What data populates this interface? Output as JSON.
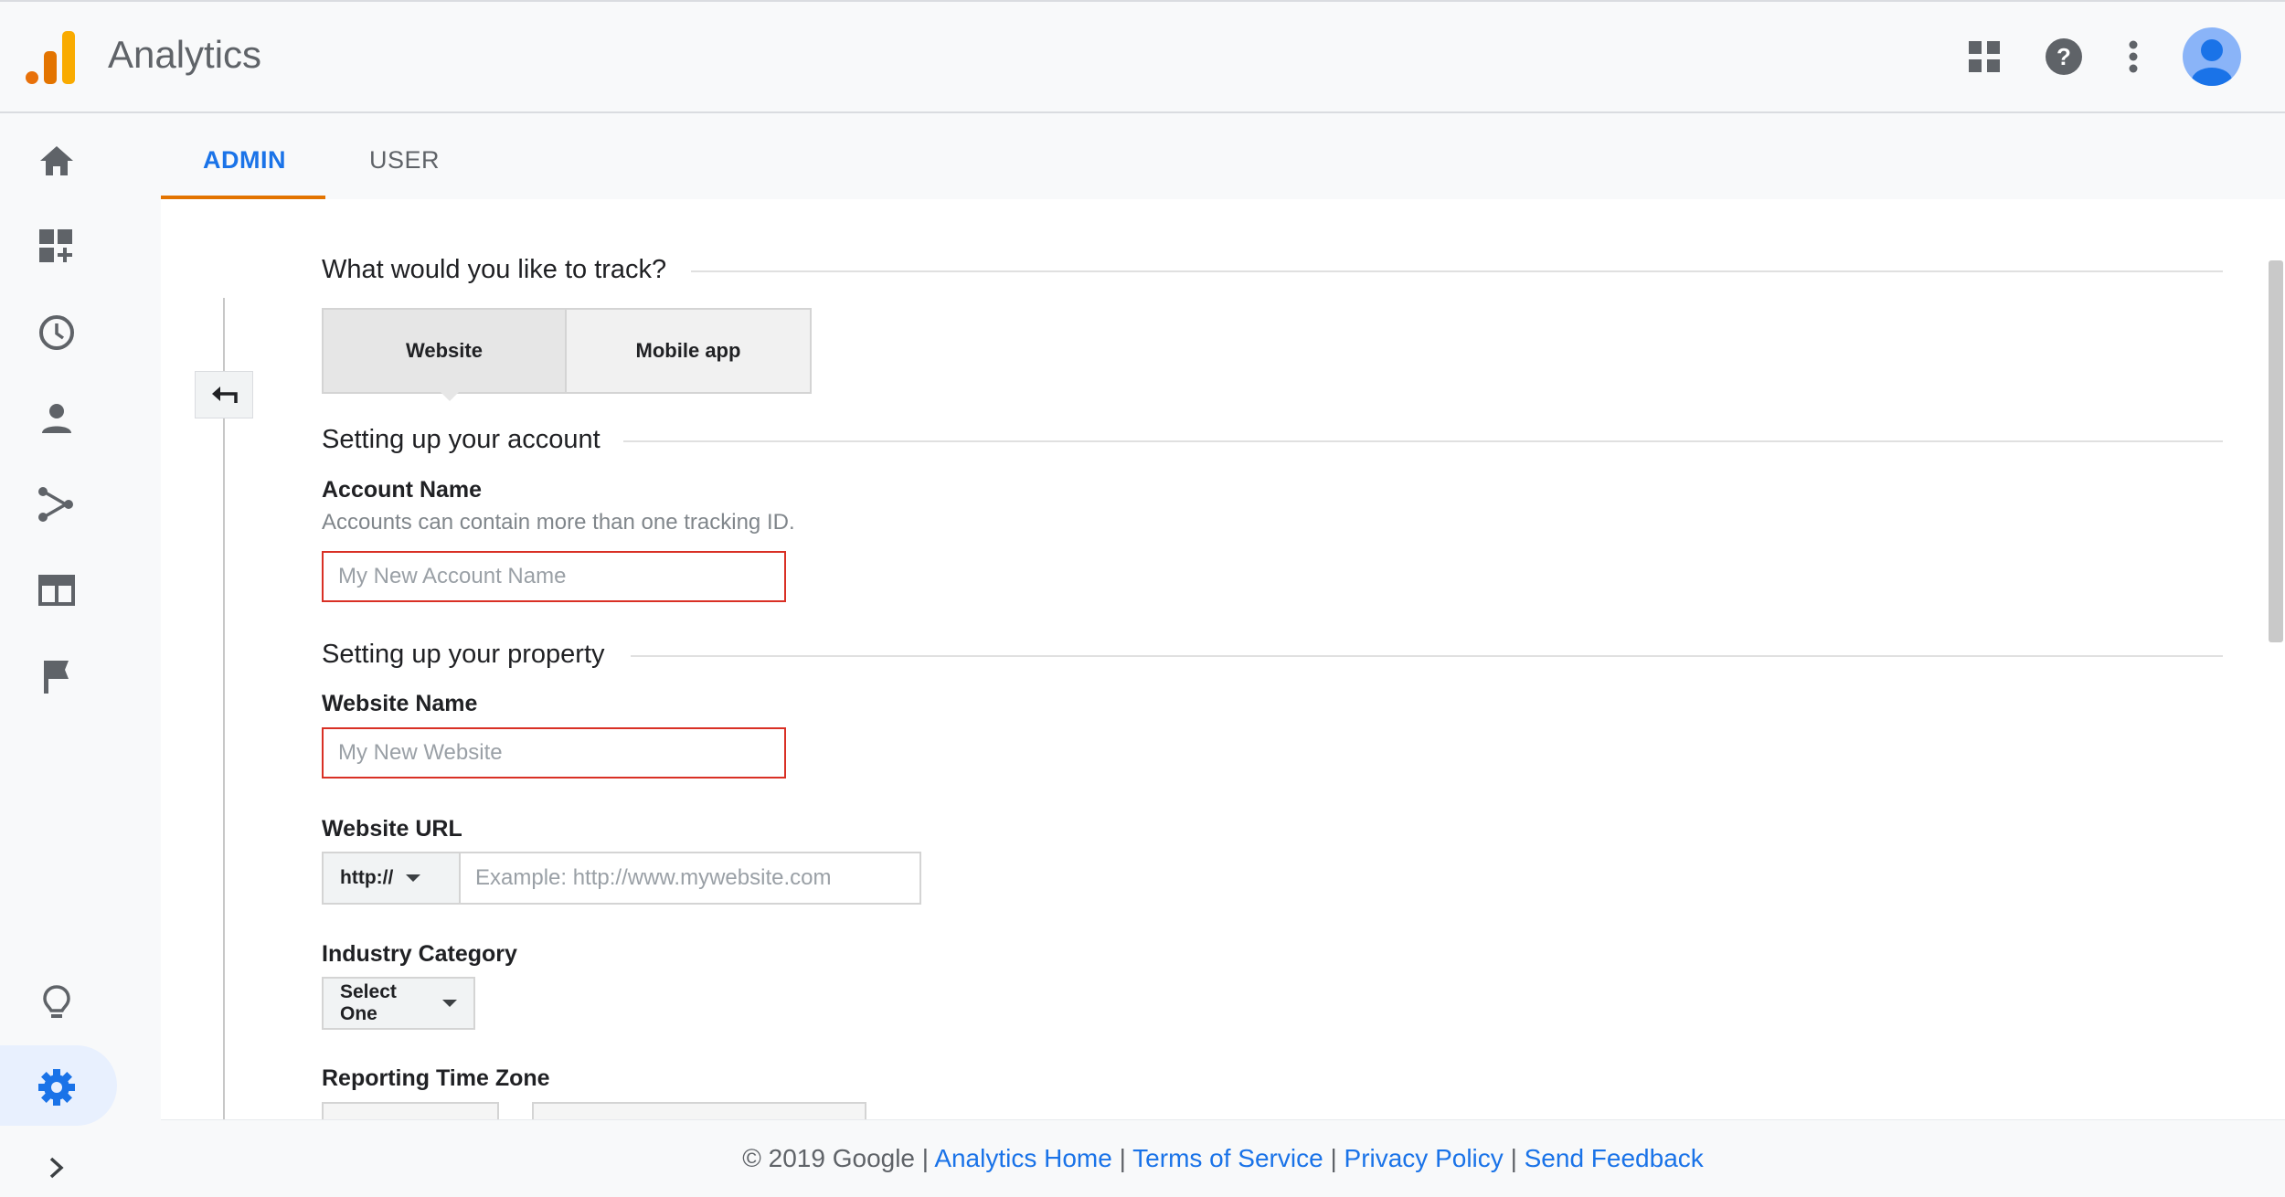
{
  "header": {
    "app_title": "Analytics",
    "logo_colors": [
      "#e37400",
      "#f9ab00",
      "#e8710a"
    ],
    "icons": [
      "apps-grid-icon",
      "help-icon",
      "more-vert-icon",
      "account-avatar-icon"
    ]
  },
  "sidebar": {
    "items": [
      {
        "name": "home-icon"
      },
      {
        "name": "customization-icon"
      },
      {
        "name": "realtime-clock-icon"
      },
      {
        "name": "audience-person-icon"
      },
      {
        "name": "acquisition-icon"
      },
      {
        "name": "behavior-icon"
      },
      {
        "name": "conversions-flag-icon"
      },
      {
        "name": "discover-lightbulb-icon"
      },
      {
        "name": "admin-gear-icon",
        "active": true
      },
      {
        "name": "expand-chevron-icon"
      }
    ]
  },
  "tabs": [
    {
      "label": "ADMIN",
      "active": true
    },
    {
      "label": "USER",
      "active": false
    }
  ],
  "form": {
    "track_title": "What would you like to track?",
    "track_options": {
      "website": "Website",
      "mobile": "Mobile app",
      "selected": "Website"
    },
    "account_section": "Setting up your account",
    "account_name_label": "Account Name",
    "account_name_hint": "Accounts can contain more than one tracking ID.",
    "account_name_placeholder": "My New Account Name",
    "property_section": "Setting up your property",
    "website_name_label": "Website Name",
    "website_name_placeholder": "My New Website",
    "website_url_label": "Website URL",
    "protocol_value": "http://",
    "website_url_placeholder": "Example: http://www.mywebsite.com",
    "industry_label": "Industry Category",
    "industry_value": "Select One",
    "timezone_label": "Reporting Time Zone"
  },
  "footer": {
    "copyright": "© 2019 Google",
    "sep": "|",
    "links": [
      "Analytics Home",
      "Terms of Service",
      "Privacy Policy",
      "Send Feedback"
    ]
  },
  "colors": {
    "accent_blue": "#1a73e8",
    "tab_underline": "#e37400",
    "error_red": "#d93025"
  }
}
